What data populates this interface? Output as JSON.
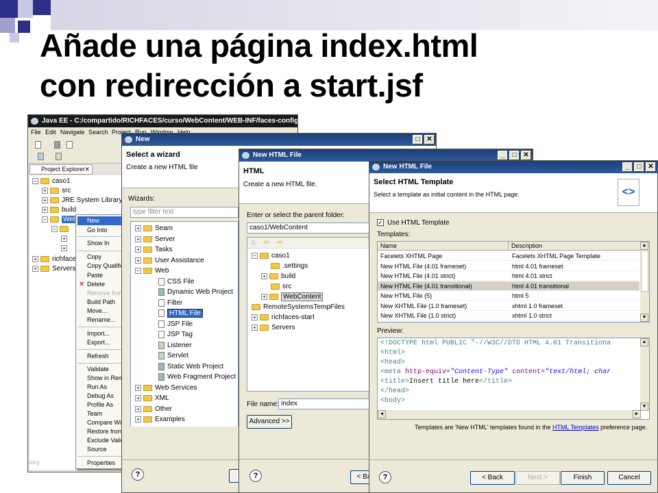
{
  "slide": {
    "title_line1": "Añade una página index.html",
    "title_line2": "con redirección a start.jsf"
  },
  "eclipse": {
    "title": "Java EE - C:/compartido/RICHFACES/curso/WebContent/WEB-INF/faces-config.xml - Ec",
    "menu": [
      "File",
      "Edit",
      "Navigate",
      "Search",
      "Project",
      "Run",
      "Window",
      "Help"
    ],
    "project_explorer_tab": "Project Explorer",
    "tree": [
      "caso1",
      "src",
      "JRE System Library [jdk",
      "build",
      "WebContent",
      "richfaces",
      "Servers"
    ],
    "watermark": "sieg",
    "context_menu": [
      "New",
      "Go Into",
      "Show In",
      "Copy",
      "Copy Qualified",
      "Paste",
      "Delete",
      "Remove from",
      "Build Path",
      "Move...",
      "Rename...",
      "Import...",
      "Export...",
      "Refresh",
      "Validate",
      "Show in Remo",
      "Run As",
      "Debug As",
      "Profile As",
      "Team",
      "Compare With",
      "Restore from L",
      "Exclude Valida",
      "Source",
      "Properties"
    ]
  },
  "wizard_new": {
    "title": "New",
    "header_title": "Select a wizard",
    "header_sub": "Create a new HTML file",
    "wizards_label": "Wizards:",
    "filter_placeholder": "type filter text",
    "tree": [
      "Seam",
      "Server",
      "Tasks",
      "User Assistance",
      "Web",
      "CSS File",
      "Dynamic Web Project",
      "Filter",
      "HTML File",
      "JSP File",
      "JSP Tag",
      "Listener",
      "Servlet",
      "Static Web Project",
      "Web Fragment Project",
      "Web Services",
      "XML",
      "Other",
      "Examples"
    ]
  },
  "new_html_file": {
    "title": "New HTML File",
    "header_title": "HTML",
    "header_sub": "Create a new HTML file.",
    "parent_label": "Enter or select the parent folder:",
    "parent_value": "caso1/WebContent",
    "tree": [
      "caso1",
      ".settings",
      "build",
      "src",
      "WebContent",
      "RemoteSystemsTempFiles",
      "richfaces-start",
      "Servers"
    ],
    "filename_label": "File name:",
    "filename_value": "index",
    "advanced_button": "Advanced >>",
    "back_button": "< Ba"
  },
  "template_dialog": {
    "title": "New HTML File",
    "header_title": "Select HTML Template",
    "header_sub": "Select a template as initial content in the HTML page.",
    "use_template_label": "Use HTML Template",
    "templates_label": "Templates:",
    "columns": [
      "Name",
      "Description"
    ],
    "rows": [
      [
        "Facelets XHTML Page",
        "Facelets XHTML Page Template"
      ],
      [
        "New HTML File (4.01 frameset)",
        "html 4.01 frameset"
      ],
      [
        "New HTML File (4.01 strict)",
        "html 4.01 strict"
      ],
      [
        "New HTML File (4.01 transitional)",
        "html 4.01 transitional"
      ],
      [
        "New HTML File (5)",
        "html 5"
      ],
      [
        "New XHTML File (1.0 frameset)",
        "xhtml 1.0 frameset"
      ],
      [
        "New XHTML File (1.0 strict)",
        "xhtml 1.0 strict"
      ]
    ],
    "selected_row": 3,
    "preview_label": "Preview:",
    "preview": {
      "l1": "<!DOCTYPE html PUBLIC \"-//W3C//DTD HTML 4.01 Transitiona",
      "l2": "<html>",
      "l3": "<head>",
      "l4_tag": "<meta",
      "l4_att1": "http-equiv=",
      "l4_val1": "\"Content-Type\"",
      "l4_att2": "content=",
      "l4_val2": "\"text/html; char",
      "l5_open": "<title>",
      "l5_text": "Insert title here",
      "l5_close": "</title>",
      "l6": "</head>",
      "l7": "<body>"
    },
    "footer_note_prefix": "Templates are 'New HTML' templates found in the",
    "footer_link": "HTML Templates",
    "footer_note_suffix": "preference page.",
    "buttons": {
      "back": "< Back",
      "next": "Next >",
      "finish": "Finish",
      "cancel": "Cancel"
    }
  }
}
